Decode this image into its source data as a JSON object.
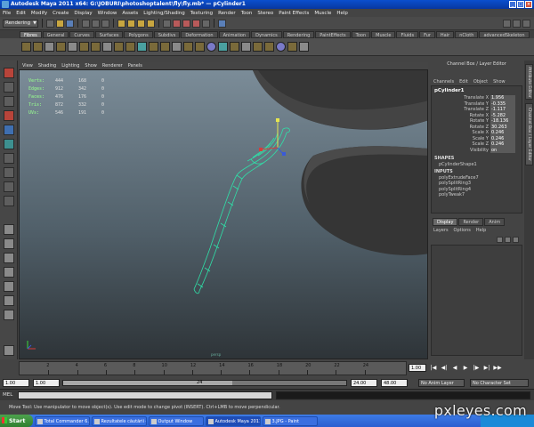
{
  "window": {
    "title": "Autodesk Maya 2011 x64: G:\\JOBURI\\photoshoptalent\\fly\\fly.mb* — pCylinder1",
    "min": "_",
    "max": "□",
    "close": "×"
  },
  "menubar": [
    "File",
    "Edit",
    "Modify",
    "Create",
    "Display",
    "Window",
    "Assets",
    "Lighting/Shading",
    "Texturing",
    "Render",
    "Toon",
    "Stereo",
    "Paint Effects",
    "Muscle",
    "Help"
  ],
  "statusline": {
    "mode": "Rendering"
  },
  "shelf": {
    "tabs": [
      "Fibres",
      "General",
      "Curves",
      "Surfaces",
      "Polygons",
      "Subdivs",
      "Deformation",
      "Animation",
      "Dynamics",
      "Rendering",
      "PaintEffects",
      "Toon",
      "Muscle",
      "Fluids",
      "Fur",
      "Hair",
      "nCloth",
      "advancedSkeleton"
    ],
    "active_tab": "Fibres"
  },
  "viewport": {
    "menu": [
      "View",
      "Shading",
      "Lighting",
      "Show",
      "Renderer",
      "Panels"
    ],
    "camera": "persp",
    "hud": [
      {
        "label": "Verts:",
        "a": "444",
        "b": "168",
        "c": "0"
      },
      {
        "label": "Edges:",
        "a": "912",
        "b": "342",
        "c": "0"
      },
      {
        "label": "Faces:",
        "a": "476",
        "b": "176",
        "c": "0"
      },
      {
        "label": "Tris:",
        "a": "872",
        "b": "332",
        "c": "0"
      },
      {
        "label": "UVs:",
        "a": "546",
        "b": "191",
        "c": "0"
      }
    ]
  },
  "channel_box": {
    "header": "Channel Box / Layer Editor",
    "menu": [
      "Channels",
      "Edit",
      "Object",
      "Show"
    ],
    "node": "pCylinder1",
    "attributes": [
      {
        "name": "Translate X",
        "value": "1.956"
      },
      {
        "name": "Translate Y",
        "value": "-0.335"
      },
      {
        "name": "Translate Z",
        "value": "-1.117"
      },
      {
        "name": "Rotate X",
        "value": "-5.282"
      },
      {
        "name": "Rotate Y",
        "value": "-18.136"
      },
      {
        "name": "Rotate Z",
        "value": "30.263"
      },
      {
        "name": "Scale X",
        "value": "0.246"
      },
      {
        "name": "Scale Y",
        "value": "0.246"
      },
      {
        "name": "Scale Z",
        "value": "0.246"
      },
      {
        "name": "Visibility",
        "value": "on"
      }
    ],
    "shapes_label": "SHAPES",
    "shapes": [
      "pCylinderShape1"
    ],
    "inputs_label": "INPUTS",
    "inputs": [
      "polyExtrudeFace7",
      "polySplitRing3",
      "polySplitRing4",
      "polyTweak7"
    ]
  },
  "layer_editor": {
    "tabs": [
      "Display",
      "Render",
      "Anim"
    ],
    "active_tab": "Display",
    "menu": [
      "Layers",
      "Options",
      "Help"
    ]
  },
  "side_tabs": [
    "Attribute Editor",
    "Channel Box / Layer Editor"
  ],
  "timeline": {
    "ticks": [
      "2",
      "4",
      "6",
      "8",
      "10",
      "12",
      "14",
      "16",
      "18",
      "20",
      "22",
      "24"
    ],
    "current_frame": "1.00",
    "playback": [
      "|◀",
      "◀|",
      "◀",
      "▶",
      "|▶",
      "▶|",
      "▶▶"
    ]
  },
  "range": {
    "start": "1.00",
    "inner_start": "1.00",
    "slider_marker": "24",
    "inner_end": "24.00",
    "end": "48.00",
    "anim_layer": "No Anim Layer",
    "char_set": "No Character Set"
  },
  "cmdline": {
    "label": "MEL"
  },
  "helpline": "Move Tool: Use manipulator to move object(s). Use edit mode to change pivot (INSERT). Ctrl+LMB to move perpendicular.",
  "taskbar": {
    "start": "Start",
    "tasks": [
      {
        "label": "Total Commander 6.03 -...",
        "active": false
      },
      {
        "label": "Rezultatele căutării de im...",
        "active": false
      },
      {
        "label": "Output Window",
        "active": false
      },
      {
        "label": "Autodesk Maya 2011 ...",
        "active": true
      },
      {
        "label": "3.JPG - Paint",
        "active": false
      }
    ]
  },
  "watermark": "pxleyes.com",
  "colors": {
    "mesh_wire": "#2fe0a8",
    "shape_fill": "#3a3a3a",
    "hud_text": "#8fe08f"
  }
}
